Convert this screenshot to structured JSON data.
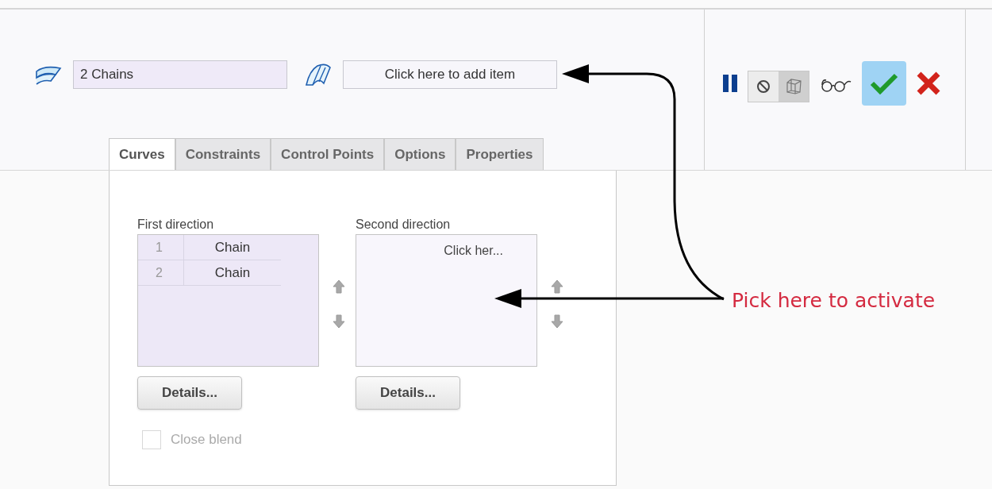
{
  "collectors": [
    {
      "kind": "chains",
      "value": "2 Chains"
    },
    {
      "kind": "cross",
      "placeholder": "Click here to add item"
    }
  ],
  "toolbar": {
    "toggles": [
      {
        "kind": "no-preview",
        "selected": false
      },
      {
        "kind": "mesh",
        "selected": true
      }
    ]
  },
  "tabs": [
    {
      "label": "Curves",
      "selected": true
    },
    {
      "label": "Constraints",
      "selected": false
    },
    {
      "label": "Control Points",
      "selected": false
    },
    {
      "label": "Options",
      "selected": false
    },
    {
      "label": "Properties",
      "selected": false
    }
  ],
  "directions": [
    {
      "label": "First direction",
      "rows": [
        {
          "index": "1",
          "name": "Chain"
        },
        {
          "index": "2",
          "name": "Chain"
        }
      ],
      "button": "Details..."
    },
    {
      "label": "Second direction",
      "placeholder": "Click her...",
      "button": "Details..."
    }
  ],
  "close_blend": {
    "label": "Close blend",
    "checked": false,
    "disabled": true
  },
  "annotation": {
    "text": "Pick here to activate"
  }
}
